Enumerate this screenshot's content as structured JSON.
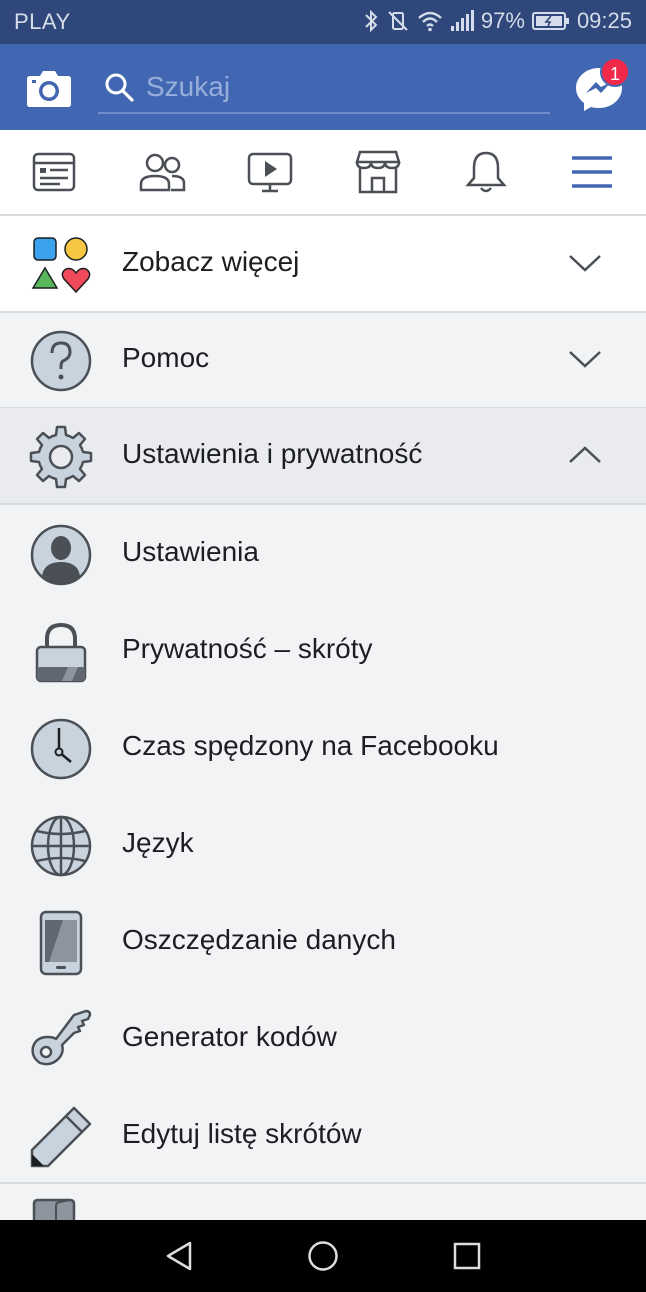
{
  "status_bar": {
    "carrier": "PLAY",
    "battery": "97%",
    "time": "09:25"
  },
  "header": {
    "search_placeholder": "Szukaj",
    "messenger_badge": "1"
  },
  "nav_icons": [
    "news-feed-icon",
    "friends-icon",
    "watch-icon",
    "marketplace-icon",
    "notifications-icon",
    "menu-icon"
  ],
  "sections": [
    {
      "label": "Zobacz więcej",
      "icon": "shapes-icon",
      "expanded": false
    },
    {
      "label": "Pomoc",
      "icon": "help-icon",
      "expanded": false
    },
    {
      "label": "Ustawienia i prywatność",
      "icon": "gear-icon",
      "expanded": true
    }
  ],
  "settings_items": [
    {
      "label": "Ustawienia",
      "icon": "profile-icon"
    },
    {
      "label": "Prywatność – skróty",
      "icon": "lock-icon"
    },
    {
      "label": "Czas spędzony na Facebooku",
      "icon": "clock-icon"
    },
    {
      "label": "Język",
      "icon": "globe-icon"
    },
    {
      "label": "Oszczędzanie danych",
      "icon": "phone-icon"
    },
    {
      "label": "Generator kodów",
      "icon": "key-icon"
    },
    {
      "label": "Edytuj listę skrótów",
      "icon": "pencil-icon"
    }
  ],
  "colors": {
    "brand_blue": "#4267b2",
    "status_bar": "#2f477a",
    "badge_red": "#f02849"
  }
}
